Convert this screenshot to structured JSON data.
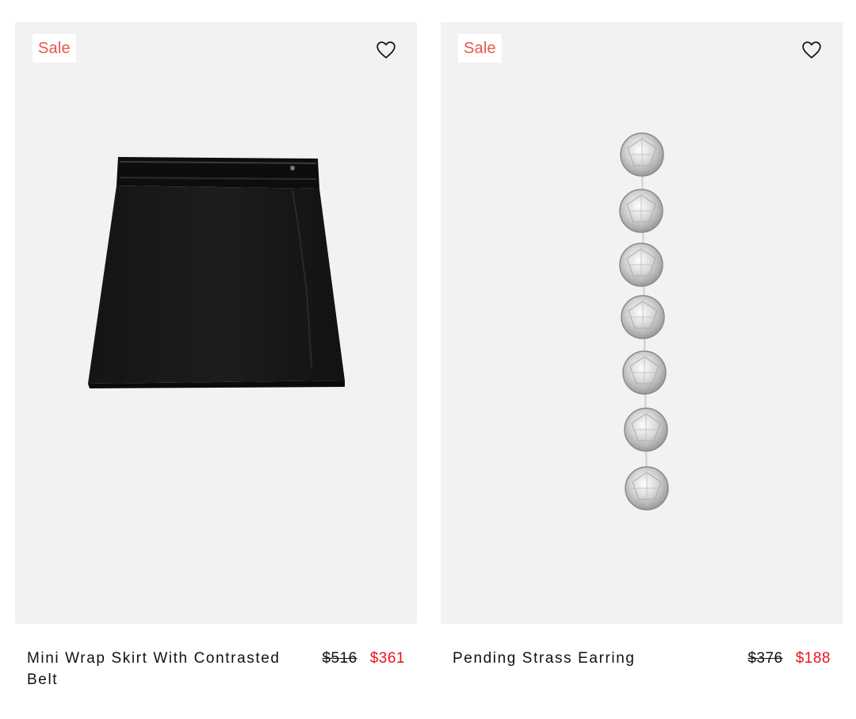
{
  "products": [
    {
      "badge": "Sale",
      "name": "Mini Wrap Skirt With Contrasted Belt",
      "price_original": "$516",
      "price_sale": "$361",
      "image_alt": "black mini wrap skirt",
      "favorite_icon": "heart-outline-icon"
    },
    {
      "badge": "Sale",
      "name": "Pending Strass Earring",
      "price_original": "$376",
      "price_sale": "$188",
      "image_alt": "crystal drop earring",
      "favorite_icon": "heart-outline-icon"
    }
  ],
  "colors": {
    "badge_text": "#e8574f",
    "sale_price": "#e8141c",
    "image_background": "#f2f2f2"
  }
}
